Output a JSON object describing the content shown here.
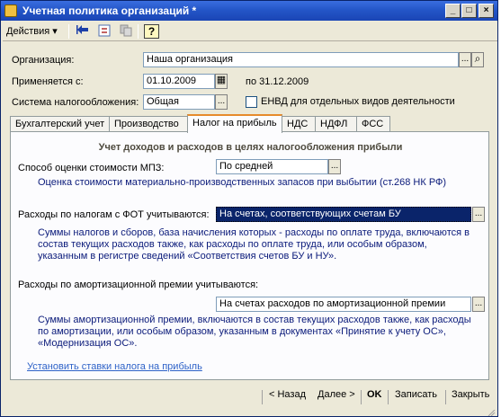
{
  "window": {
    "title": "Учетная политика организаций *"
  },
  "titlebar_buttons": {
    "minimize": "_",
    "maximize": "□",
    "close": "×"
  },
  "toolbar": {
    "actions_label": "Действия",
    "actions_arrow": "▾",
    "icons": [
      "back-arrow-icon",
      "refresh-icon",
      "copy-icon",
      "help-icon"
    ],
    "help_glyph": "?"
  },
  "form": {
    "organization_label": "Организация:",
    "organization_value": "Наша организация",
    "applies_from_label": "Применяется с:",
    "applies_from_value": "01.10.2009",
    "applies_to_text": "по 31.12.2009",
    "tax_system_label": "Система налогообложения:",
    "tax_system_value": "Общая",
    "envd_label": "ЕНВД для отдельных видов деятельности",
    "envd_checked": false
  },
  "tabs": [
    {
      "label": "Бухгалтерский учет",
      "active": false
    },
    {
      "label": "Производство",
      "active": false
    },
    {
      "label": "Налог на прибыль",
      "active": true
    },
    {
      "label": "НДС",
      "active": false
    },
    {
      "label": "НДФЛ",
      "active": false
    },
    {
      "label": "ФСС",
      "active": false
    }
  ],
  "panel": {
    "section_title": "Учет доходов и расходов в целях налогообложения прибыли",
    "mpz_label": "Способ оценки стоимости МПЗ:",
    "mpz_value": "По средней",
    "mpz_note": "Оценка стоимости материально-производственных запасов при выбытии (ст.268 НК РФ)",
    "fot_label": "Расходы по налогам с ФОТ учитываются:",
    "fot_value": "На счетах, соответствующих счетам БУ",
    "fot_note_1": "Суммы налогов и сборов, база начисления которых - расходы по оплате труда, включаются в",
    "fot_note_2": "состав текущих расходов также, как расходы по оплате труда, или особым образом,",
    "fot_note_3": "указанным в регистре сведений «Соответствия счетов БУ и НУ».",
    "amort_label": "Расходы по амортизационной премии учитываются:",
    "amort_value": "На счетах расходов по амортизационной премии",
    "amort_note_1": "Суммы амортизационной премии, включаются в состав текущих расходов также, как расходы",
    "amort_note_2": "по амортизации, или особым образом, указанным в документах «Принятие к учету ОС»,",
    "amort_note_3": "«Модернизация ОС».",
    "rates_link": "Установить ставки налога на прибыль"
  },
  "bottom": {
    "back_label": "< Назад",
    "next_label": "Далее >",
    "ok_label": "OK",
    "save_label": "Записать",
    "close_label": "Закрыть"
  },
  "ellipsis": "...",
  "magnifier": "⌕",
  "calendar": "▦"
}
